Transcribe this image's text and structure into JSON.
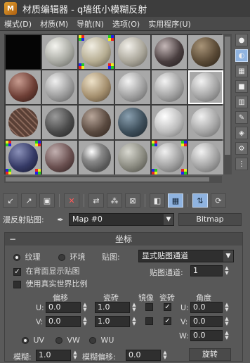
{
  "window": {
    "title": "材质编辑器 - q墙纸小模糊反射"
  },
  "menu": [
    "模式(D)",
    "材质(M)",
    "导航(N)",
    "选项(O)",
    "实用程序(U)"
  ],
  "material_name": {
    "label": "漫反射贴图:",
    "value": "Map #0",
    "type_button": "Bitmap"
  },
  "rollout": {
    "title": "坐标",
    "texture_label": "纹理",
    "environ_label": "环境",
    "mapping_label": "贴图:",
    "mapping_value": "显式贴图通道",
    "show_on_back_label": "在背面显示贴图",
    "real_world_label": "使用真实世界比例",
    "map_channel_label": "贴图通道:",
    "map_channel_value": "1",
    "col_offset": "偏移",
    "col_tiling": "瓷砖",
    "col_mirror": "镜像",
    "col_tile": "瓷砖",
    "col_angle": "角度",
    "u_label": "U:",
    "v_label": "V:",
    "w_label": "W:",
    "u_offset": "0.0",
    "v_offset": "0.0",
    "u_tiling": "1.0",
    "v_tiling": "1.0",
    "u_angle": "0.0",
    "v_angle": "0.0",
    "w_angle": "0.0",
    "uv_label": "UV",
    "vw_label": "VW",
    "wu_label": "WU",
    "blur_label": "模糊:",
    "blur_value": "1.0",
    "blur_offset_label": "模糊偏移:",
    "blur_offset_value": "0.0",
    "rotate_button": "旋转"
  }
}
